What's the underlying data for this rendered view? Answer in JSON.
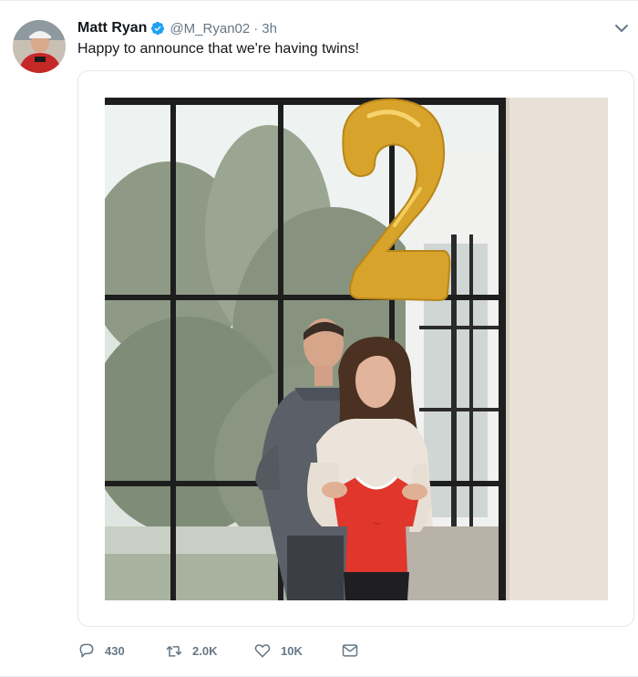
{
  "tweet": {
    "author_name": "Matt Ryan",
    "handle": "@M_Ryan02",
    "separator": "·",
    "time": "3h",
    "text": "Happy to announce that we're having twins!",
    "verified": true
  },
  "actions": {
    "replies": "430",
    "retweets": "2.0K",
    "likes": "10K"
  },
  "icons": {
    "verified": "verified-badge-icon",
    "more": "chevron-down-icon",
    "reply": "reply-icon",
    "retweet": "retweet-icon",
    "like": "heart-icon",
    "message": "envelope-icon"
  },
  "colors": {
    "accent": "#1da1f2",
    "text": "#14171a",
    "muted": "#657786",
    "border": "#e1e8ed",
    "balloon": "#d9a62a",
    "jersey": "#e0362b"
  }
}
